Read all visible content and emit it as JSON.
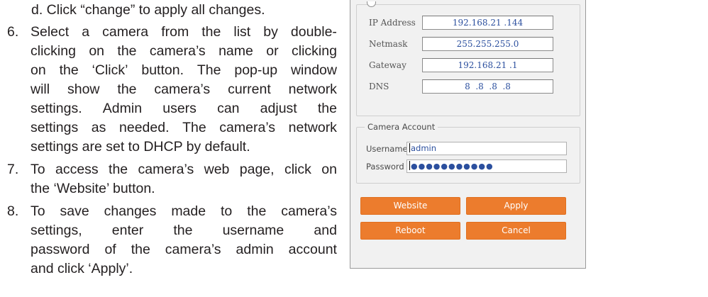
{
  "instructions": {
    "step_d": "d. Click “change” to apply all changes.",
    "step6": {
      "number": "6.",
      "lines": [
        [
          "Select",
          "a",
          "camera",
          "from",
          "the",
          "list",
          "by",
          "double-"
        ],
        [
          "clicking",
          "on",
          "the",
          "camera’s",
          "name",
          "or",
          "clicking"
        ],
        [
          "on",
          "the",
          "‘Click’",
          "button.",
          "The",
          "pop-up",
          "window"
        ],
        [
          "will",
          "show",
          "the",
          "camera’s",
          "current",
          "network"
        ],
        [
          "settings.",
          "Admin",
          "users",
          "can",
          "adjust",
          "the"
        ],
        [
          "settings",
          "as",
          "needed.",
          "The",
          "camera’s",
          "network"
        ]
      ],
      "last": "settings are set to DHCP by default."
    },
    "step7": {
      "number": "7.",
      "lines": [
        [
          "To",
          "access",
          "the",
          "camera’s",
          "web",
          "page,",
          "click",
          "on"
        ]
      ],
      "last": "the ‘Website’ button."
    },
    "step8": {
      "number": "8.",
      "lines": [
        [
          "To",
          "save",
          "changes",
          "made",
          "to",
          "the",
          "camera’s"
        ],
        [
          "settings,",
          "enter",
          "the",
          "username",
          "and"
        ],
        [
          "password",
          "of",
          "the",
          "camera’s",
          "admin",
          "account"
        ]
      ],
      "last": "and click ‘Apply’."
    }
  },
  "dialog": {
    "network": {
      "ip_label": "IP Address",
      "ip_value": "192.168.21 .144",
      "netmask_label": "Netmask",
      "netmask_value": "255.255.255.0",
      "gateway_label": "Gateway",
      "gateway_value": "192.168.21 .1",
      "dns_label": "DNS",
      "dns_value": "8  .8  .8  .8"
    },
    "account": {
      "title": "Camera Account",
      "username_label": "Username",
      "username_value": "admin",
      "password_label": "Password",
      "password_value": "●●●●●●●●●●●"
    },
    "buttons": {
      "website": "Website",
      "apply": "Apply",
      "reboot": "Reboot",
      "cancel": "Cancel"
    },
    "accent_color": "#ec7c2d"
  }
}
